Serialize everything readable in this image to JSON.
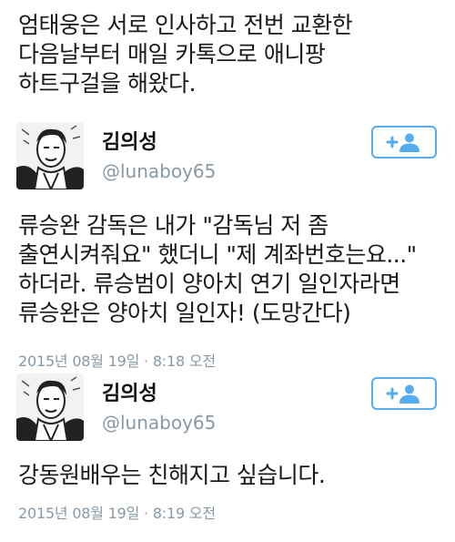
{
  "top_text": "엄태웅은 서로 인사하고 전번 교환한\n다음날부터 매일 카톡으로 애니팡\n하트구걸을 해왔다.",
  "tweets": [
    {
      "display_name": "김의성",
      "handle": "@lunaboy65",
      "body": "류승완 감독은 내가 \"감독님 저 좀\n출연시켜줘요\" 했더니 \"제 계좌번호는요...\"\n하더라. 류승범이 양아치 연기 일인자라면\n류승완은 양아치 일인자! (도망간다)",
      "timestamp": "2015년 08월 19일 · 8:18 오전"
    },
    {
      "display_name": "김의성",
      "handle": "@lunaboy65",
      "body": "강동원배우는 친해지고 싶습니다.",
      "timestamp": "2015년 08월 19일 · 8:19 오전"
    }
  ],
  "icons": {
    "avatar": "avatar-portrait-sketch",
    "follow": "add-user-icon"
  },
  "colors": {
    "accent": "#55acee",
    "muted": "#8899a6",
    "text": "#1a1a1a"
  }
}
